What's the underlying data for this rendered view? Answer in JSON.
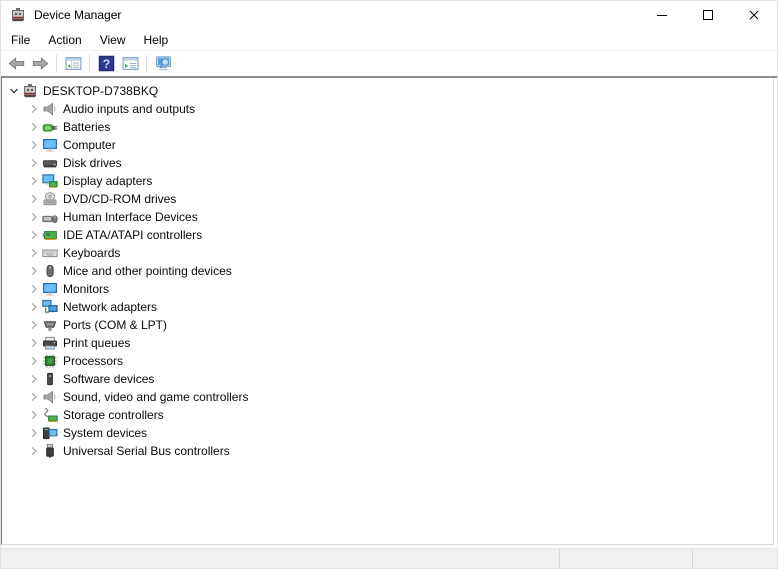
{
  "window": {
    "title": "Device Manager",
    "controls": [
      "minimize-icon",
      "maximize-icon",
      "close-icon"
    ]
  },
  "menubar": {
    "items": [
      "File",
      "Action",
      "View",
      "Help"
    ]
  },
  "toolbar": {
    "icons": [
      "back-icon",
      "forward-icon",
      "show-console-tree-icon",
      "help-icon",
      "properties-icon",
      "scan-hardware-changes-icon"
    ]
  },
  "tree": {
    "root": {
      "label": "DESKTOP-D738BKQ",
      "icon": "device-manager-icon",
      "expanded": true
    },
    "items": [
      {
        "label": "Audio inputs and outputs",
        "icon": "speaker-icon"
      },
      {
        "label": "Batteries",
        "icon": "battery-icon"
      },
      {
        "label": "Computer",
        "icon": "computer-monitor-icon"
      },
      {
        "label": "Disk drives",
        "icon": "disk-drive-icon"
      },
      {
        "label": "Display adapters",
        "icon": "display-adapter-icon"
      },
      {
        "label": "DVD/CD-ROM drives",
        "icon": "cd-drive-icon"
      },
      {
        "label": "Human Interface Devices",
        "icon": "hid-icon"
      },
      {
        "label": "IDE ATA/ATAPI controllers",
        "icon": "ata-controller-icon"
      },
      {
        "label": "Keyboards",
        "icon": "keyboard-icon"
      },
      {
        "label": "Mice and other pointing devices",
        "icon": "mouse-icon"
      },
      {
        "label": "Monitors",
        "icon": "monitor-icon"
      },
      {
        "label": "Network adapters",
        "icon": "network-adapter-icon"
      },
      {
        "label": "Ports (COM & LPT)",
        "icon": "serial-port-icon"
      },
      {
        "label": "Print queues",
        "icon": "printer-icon"
      },
      {
        "label": "Processors",
        "icon": "processor-icon"
      },
      {
        "label": "Software devices",
        "icon": "software-device-icon"
      },
      {
        "label": "Sound, video and game controllers",
        "icon": "sound-icon"
      },
      {
        "label": "Storage controllers",
        "icon": "storage-controller-icon"
      },
      {
        "label": "System devices",
        "icon": "system-device-icon"
      },
      {
        "label": "Universal Serial Bus controllers",
        "icon": "usb-icon"
      }
    ]
  },
  "statusbar": {
    "segments": 3
  },
  "colors": {
    "monitor_blue": "#4aa3e8",
    "card_green": "#4caf50",
    "battery_green": "#57b447",
    "help_navy": "#2b3a8f",
    "toolbar_line": "#8c8c8c",
    "statusbar_bg": "#f0f0f0"
  }
}
